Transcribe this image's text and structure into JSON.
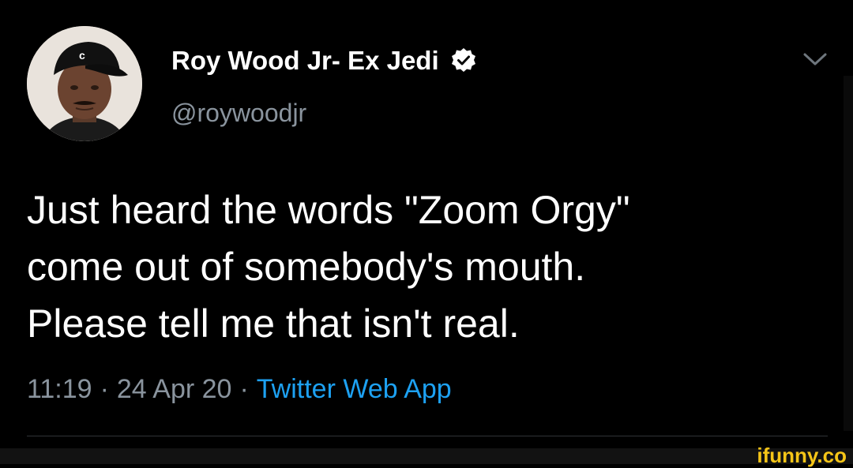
{
  "user": {
    "display_name": "Roy Wood Jr- Ex Jedi",
    "handle": "@roywoodjr",
    "verified": true,
    "avatar_icon": "profile-photo"
  },
  "tweet": {
    "lines": [
      "Just heard the words \"Zoom Orgy\"",
      "come out of somebody's mouth.",
      "Please tell me that isn't real."
    ]
  },
  "meta": {
    "time": "11:19",
    "separator": "·",
    "date": "24 Apr 20",
    "source": "Twitter Web App"
  },
  "icons": {
    "verified": "verified-badge-icon",
    "menu": "chevron-down-icon"
  },
  "colors": {
    "background": "#000000",
    "text": "#ffffff",
    "secondary_text": "#8a949e",
    "link": "#1da1f2",
    "watermark": "#f5c518"
  },
  "watermark": {
    "text": "ifunny.co"
  }
}
